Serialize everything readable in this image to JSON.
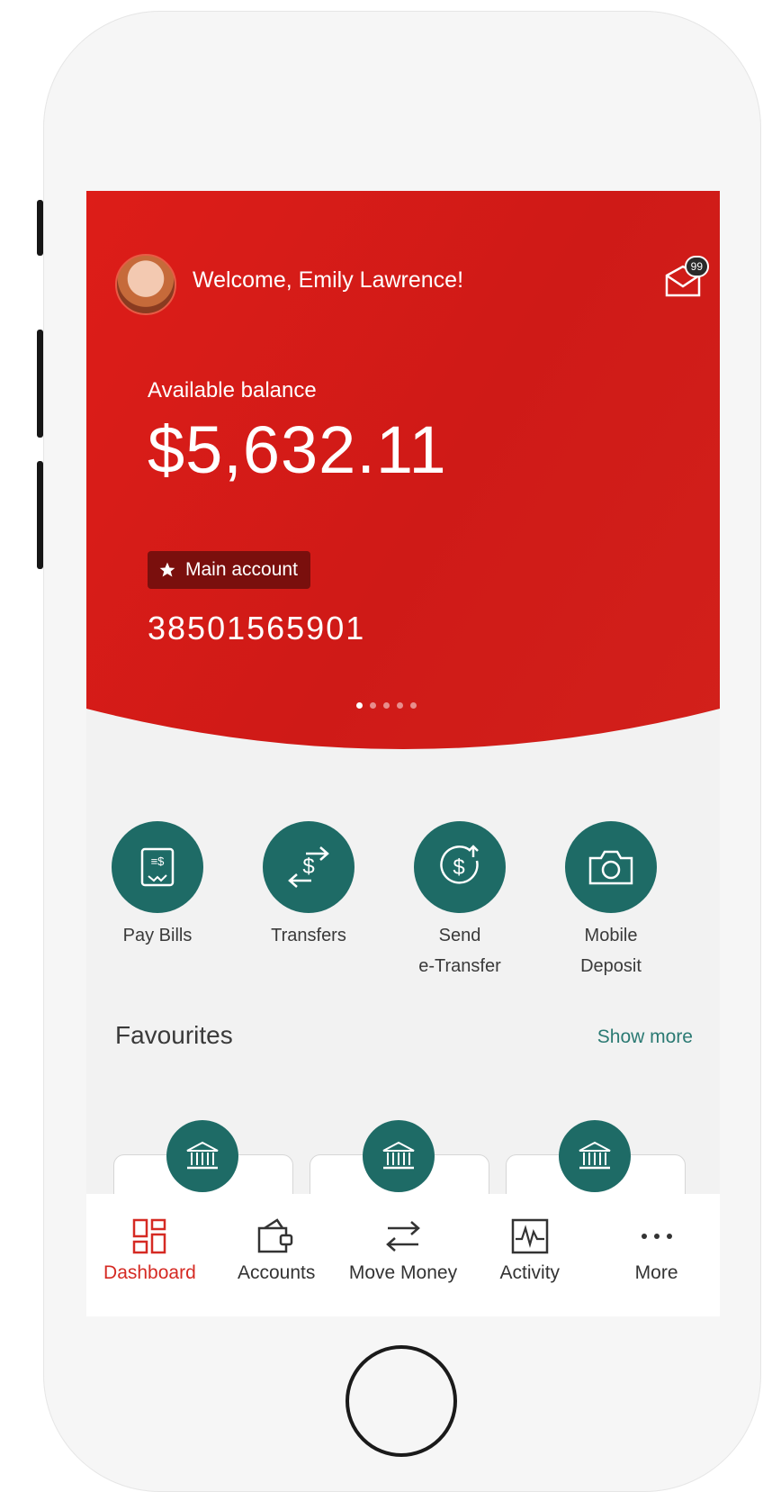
{
  "header": {
    "welcome_text": "Welcome, Emily Lawrence!",
    "mail_badge": "99"
  },
  "balance": {
    "label": "Available balance",
    "amount": "$5,632.11",
    "account_tag": "Main account",
    "account_number": "38501565901",
    "carousel_pages": 5,
    "carousel_active": 1
  },
  "quick_actions": [
    {
      "label_line1": "Pay Bills",
      "label_line2": ""
    },
    {
      "label_line1": "Transfers",
      "label_line2": ""
    },
    {
      "label_line1": "Send",
      "label_line2": "e-Transfer"
    },
    {
      "label_line1": "Mobile",
      "label_line2": "Deposit"
    }
  ],
  "favourites": {
    "title": "Favourites",
    "show_more": "Show more"
  },
  "tabs": [
    {
      "label": "Dashboard",
      "icon": "dashboard-icon",
      "active": true
    },
    {
      "label": "Accounts",
      "icon": "wallet-icon",
      "active": false
    },
    {
      "label": "Move Money",
      "icon": "swap-arrows-icon",
      "active": false
    },
    {
      "label": "Activity",
      "icon": "activity-chart-icon",
      "active": false
    },
    {
      "label": "More",
      "icon": "more-dots-icon",
      "active": false
    }
  ],
  "colors": {
    "hero_red": "#dd1d18",
    "teal": "#1e6b66",
    "active_tab": "#d52a23"
  }
}
